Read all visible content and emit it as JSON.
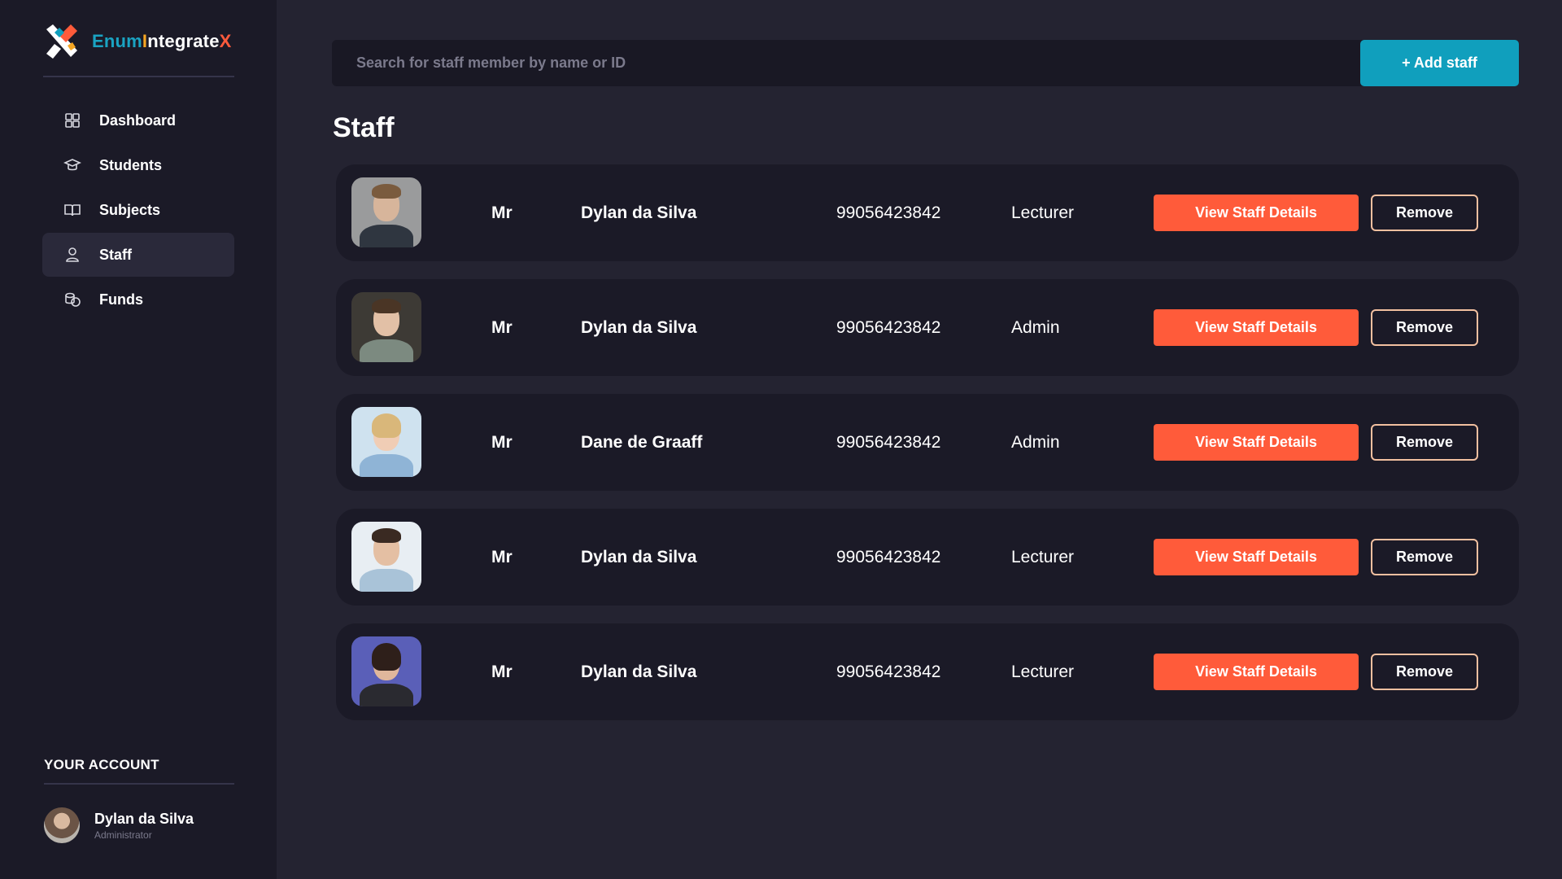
{
  "brand": {
    "name_part1": "Enum",
    "name_part2": "I",
    "name_part3": "ntegrate",
    "name_part4": "X"
  },
  "sidebar": {
    "items": [
      {
        "label": "Dashboard",
        "icon": "grid-icon",
        "active": false
      },
      {
        "label": "Students",
        "icon": "graduation-cap-icon",
        "active": false
      },
      {
        "label": "Subjects",
        "icon": "book-icon",
        "active": false
      },
      {
        "label": "Staff",
        "icon": "user-icon",
        "active": true
      },
      {
        "label": "Funds",
        "icon": "coins-icon",
        "active": false
      }
    ],
    "account_title": "YOUR ACCOUNT",
    "account": {
      "name": "Dylan da Silva",
      "role": "Administrator"
    }
  },
  "toolbar": {
    "search_placeholder": "Search for staff member by name or ID",
    "add_label": "+ Add staff"
  },
  "page_title": "Staff",
  "staff": [
    {
      "title": "Mr",
      "name": "Dylan da Silva",
      "id": "99056423842",
      "role": "Lecturer",
      "view_label": "View Staff Details",
      "remove_label": "Remove"
    },
    {
      "title": "Mr",
      "name": "Dylan da Silva",
      "id": "99056423842",
      "role": "Admin",
      "view_label": "View Staff Details",
      "remove_label": "Remove"
    },
    {
      "title": "Mr",
      "name": "Dane de Graaff",
      "id": "99056423842",
      "role": "Admin",
      "view_label": "View Staff Details",
      "remove_label": "Remove"
    },
    {
      "title": "Mr",
      "name": "Dylan da Silva",
      "id": "99056423842",
      "role": "Lecturer",
      "view_label": "View Staff Details",
      "remove_label": "Remove"
    },
    {
      "title": "Mr",
      "name": "Dylan da Silva",
      "id": "99056423842",
      "role": "Lecturer",
      "view_label": "View Staff Details",
      "remove_label": "Remove"
    }
  ],
  "colors": {
    "accent_orange": "#ff5b3a",
    "accent_teal": "#109fbd",
    "sidebar_bg": "#1b1a27",
    "main_bg": "#242331"
  }
}
